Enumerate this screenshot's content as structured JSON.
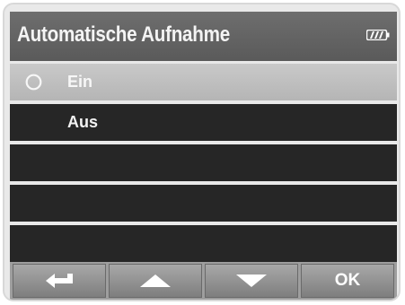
{
  "header": {
    "title": "Automatische Aufnahme",
    "battery_icon": "battery-icon"
  },
  "menu": {
    "items": [
      {
        "label": "Ein",
        "selected": true,
        "radio_icon": "radio-circle-icon"
      },
      {
        "label": "Aus",
        "selected": false
      },
      {
        "label": "",
        "selected": false
      },
      {
        "label": "",
        "selected": false
      },
      {
        "label": "",
        "selected": false
      }
    ]
  },
  "footer": {
    "buttons": [
      {
        "name": "back-button",
        "icon": "return-arrow-icon"
      },
      {
        "name": "up-button",
        "icon": "triangle-up-icon"
      },
      {
        "name": "down-button",
        "icon": "triangle-down-icon"
      },
      {
        "name": "ok-button",
        "label": "OK"
      }
    ]
  },
  "colors": {
    "header_bg": "#626262",
    "row_bg": "#262626",
    "selected_row_bg": "#bebebe",
    "footer_bg": "#9e9e9e"
  }
}
